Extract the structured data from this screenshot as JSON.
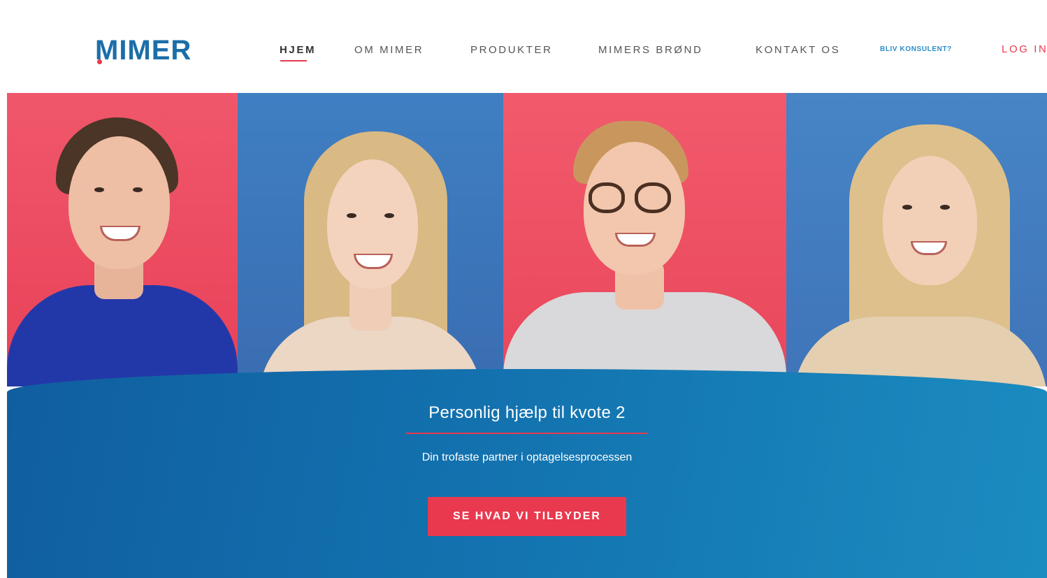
{
  "brand": {
    "logo": "MIMER",
    "primary": "#1b6fa8",
    "accent": "#e8394f",
    "light_blue": "#2b8dc8"
  },
  "nav": {
    "items": [
      {
        "label": "HJEM",
        "active": true
      },
      {
        "label": "OM MIMER",
        "active": false
      },
      {
        "label": "PRODUKTER",
        "active": false
      },
      {
        "label": "MIMERS BRØND",
        "active": false
      },
      {
        "label": "KONTAKT OS",
        "active": false
      }
    ],
    "become_consultant": "BLIV KONSULENT?",
    "login": "LOG IN"
  },
  "hero": {
    "title": "Personlig hjælp til kvote 2",
    "subtitle": "Din trofaste partner i optagelsesprocessen",
    "cta": "SE HVAD VI TILBYDER"
  }
}
